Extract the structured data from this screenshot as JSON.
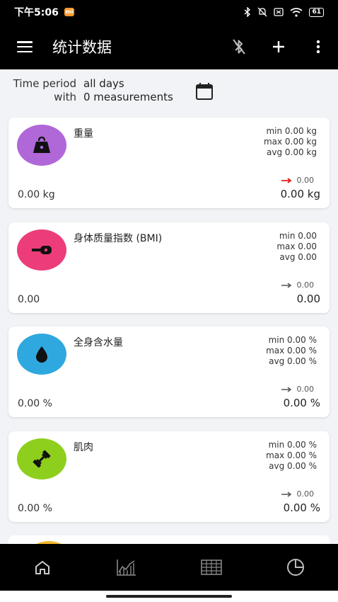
{
  "status_bar": {
    "time": "下午5:06",
    "mi_badge": "mi",
    "battery": "61"
  },
  "app_bar": {
    "title": "统计数据"
  },
  "period": {
    "time_period_label": "Time period",
    "time_period_value": "all days",
    "with_label": "with",
    "with_value": "0 measurements"
  },
  "cards": [
    {
      "name": "重量",
      "color": "#b067d8",
      "icon": "weight-icon",
      "min": "min 0.00 kg",
      "max": "max 0.00 kg",
      "avg": "avg 0.00 kg",
      "trend": "0.00",
      "trend_color": "#e0201b",
      "left_value": "0.00 kg",
      "right_value": "0.00 kg"
    },
    {
      "name": "身体质量指数 (BMI)",
      "color": "#ec3d7a",
      "icon": "tape-measure-icon",
      "min": "min 0.00",
      "max": "max 0.00",
      "avg": "avg 0.00",
      "trend": "0.00",
      "trend_color": "#555555",
      "left_value": "0.00",
      "right_value": "0.00"
    },
    {
      "name": "全身含水量",
      "color": "#2fa8df",
      "icon": "water-drop-icon",
      "min": "min 0.00 %",
      "max": "max 0.00 %",
      "avg": "avg 0.00 %",
      "trend": "0.00",
      "trend_color": "#555555",
      "left_value": "0.00 %",
      "right_value": "0.00 %"
    },
    {
      "name": "肌肉",
      "color": "#8ecf1d",
      "icon": "dumbbell-icon",
      "min": "min 0.00 %",
      "max": "max 0.00 %",
      "avg": "avg 0.00 %",
      "trend": "0.00",
      "trend_color": "#555555",
      "left_value": "0.00 %",
      "right_value": "0.00 %"
    }
  ],
  "bottom_nav": [
    {
      "icon": "home-icon"
    },
    {
      "icon": "chart-icon"
    },
    {
      "icon": "table-icon"
    },
    {
      "icon": "pie-chart-icon"
    }
  ]
}
